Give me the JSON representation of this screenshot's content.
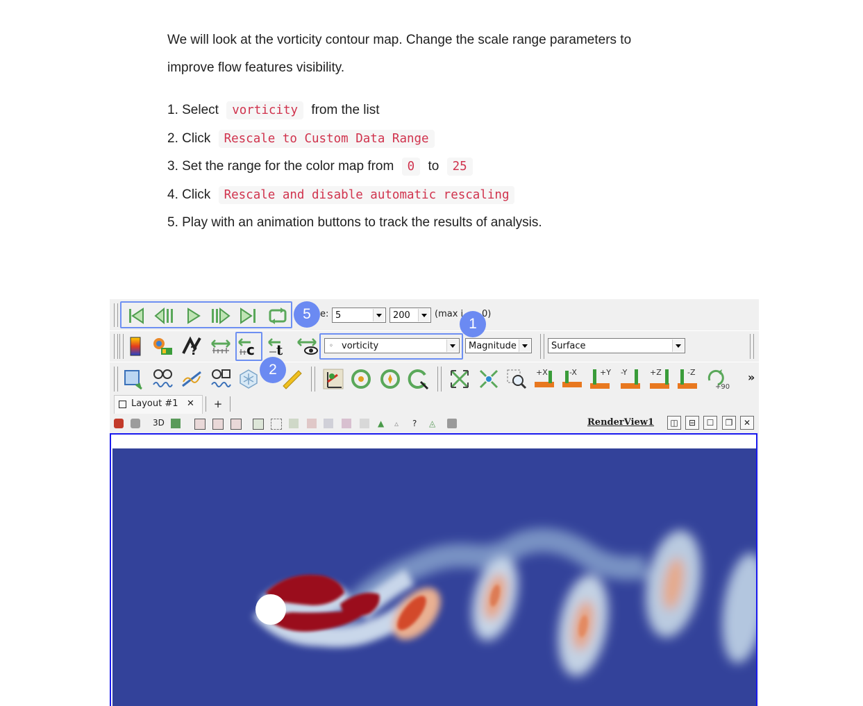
{
  "intro": {
    "line1": "We will look at the vorticity contour map. Change the scale range parameters to",
    "line2": "improve flow features visibility."
  },
  "steps": [
    {
      "pre": "1. Select",
      "code": "vorticity",
      "post": "from the list"
    },
    {
      "pre": "2. Click",
      "code": "Rescale to Custom Data Range"
    },
    {
      "pre": "3. Set the range for the color map from",
      "code": "0",
      "mid": "to",
      "code2": "25"
    },
    {
      "pre": "4. Click",
      "code": "Rescale and disable automatic rescaling"
    },
    {
      "pre": "5. Play with an animation buttons to track the results of analysis."
    }
  ],
  "toolbar1": {
    "time_label": "e:",
    "time_value": "5",
    "max_value": "200",
    "max_label": "(max i",
    "max_label_end": "0)"
  },
  "toolbar2": {
    "array_value": "vorticity",
    "component_value": "Magnitude",
    "representation_value": "Surface"
  },
  "toolbar3": {
    "camera_labels": [
      "+X",
      "-X",
      "+Y",
      "-Y",
      "+Z",
      "-Z"
    ],
    "rotate_label": "+90",
    "overflow": "»"
  },
  "tabs": {
    "layout_label": "Layout #1",
    "add_label": "+"
  },
  "subbar": {
    "mode_label": "3D",
    "view_name": "RenderView1"
  },
  "badges": {
    "b5": "5",
    "b1": "1",
    "b2": "2"
  },
  "colors": {
    "accent": "#6b8af2",
    "code_text": "#d0334d",
    "vortex_low": "#33429a",
    "vortex_high": "#9a0d1a"
  }
}
